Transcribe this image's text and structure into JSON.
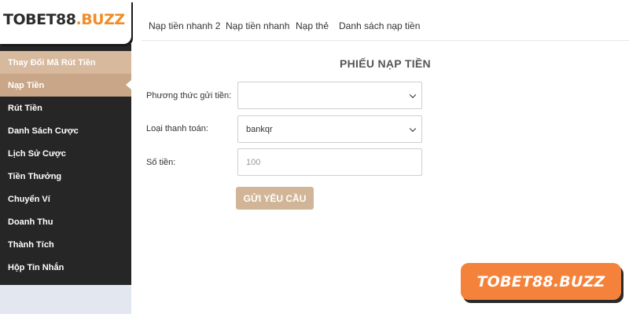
{
  "brand": {
    "logo_part1": "TOBET88",
    "logo_part2": ".BUZZ",
    "watermark": "TOBET88.BUZZ"
  },
  "sidebar": {
    "items": [
      {
        "label": "Thay Đổi Mã Rút Tiền"
      },
      {
        "label": "Nạp Tiền",
        "active": true
      },
      {
        "label": "Rút Tiền"
      },
      {
        "label": "Danh Sách Cược"
      },
      {
        "label": "Lịch Sử Cược"
      },
      {
        "label": "Tiền Thưởng"
      },
      {
        "label": "Chuyển Ví"
      },
      {
        "label": "Doanh Thu"
      },
      {
        "label": "Thành Tích"
      },
      {
        "label": "Hộp Tin Nhắn"
      }
    ]
  },
  "tabs": [
    {
      "label": "Nạp tiền nhanh 2"
    },
    {
      "label": "Nạp tiền nhanh"
    },
    {
      "label": "Nạp thẻ"
    },
    {
      "label": "Danh sách nạp tiền"
    }
  ],
  "form": {
    "title": "PHIẾU NẠP TIỀN",
    "method_label": "Phương thức gửi tiền:",
    "method_value": "",
    "payment_type_label": "Loại thanh toán:",
    "payment_type_value": "bankqr",
    "amount_label": "Số tiền:",
    "amount_placeholder": "100",
    "submit_label": "GỬI YÊU CẦU"
  },
  "colors": {
    "accent_tan": "#d2b597",
    "sidebar_dark": "#262626",
    "brand_orange": "#f5823a"
  }
}
